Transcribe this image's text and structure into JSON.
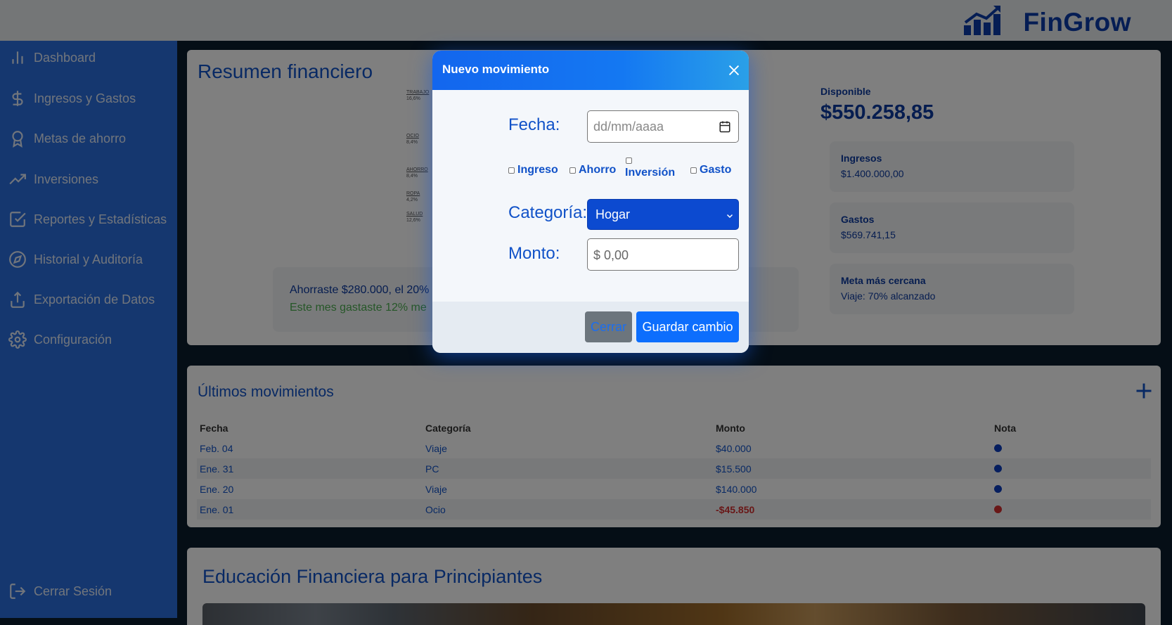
{
  "brand": {
    "name": "FinGrow",
    "logo_icon": "growth-chart-icon"
  },
  "sidebar": {
    "items": [
      {
        "label": "Dashboard",
        "icon": "bar-chart-icon"
      },
      {
        "label": "Ingresos y Gastos",
        "icon": "dollar-icon"
      },
      {
        "label": "Metas de ahorro",
        "icon": "award-icon"
      },
      {
        "label": "Inversiones",
        "icon": "trending-up-icon"
      },
      {
        "label": "Reportes y Estadísticas",
        "icon": "check-square-icon"
      },
      {
        "label": "Historial y Auditoría",
        "icon": "compass-icon"
      },
      {
        "label": "Exportación de Datos",
        "icon": "upload-icon"
      },
      {
        "label": "Configuración",
        "icon": "gear-icon"
      }
    ],
    "logout": {
      "label": "Cerrar Sesión",
      "icon": "logout-icon"
    }
  },
  "summary": {
    "title": "Resumen financiero",
    "chart_labels": [
      {
        "name": "TRABAJO",
        "pct": "16,6%"
      },
      {
        "name": "OCIO",
        "pct": "8,4%"
      },
      {
        "name": "AHORRO",
        "pct": "8,4%"
      },
      {
        "name": "ROPA",
        "pct": "4,2%"
      },
      {
        "name": "SALUD",
        "pct": "12,6%"
      }
    ],
    "tip_line1": "Ahorraste $280.000, el 20%",
    "tip_line2": "Este mes gastaste 12% me",
    "available_label": "Disponible",
    "available_value": "$550.258,85",
    "stats": [
      {
        "label": "Ingresos",
        "value": "$1.400.000,00"
      },
      {
        "label": "Gastos",
        "value": "$569.741,15"
      },
      {
        "label": "Meta más cercana",
        "value": "Viaje: 70% alcanzado"
      }
    ]
  },
  "movements": {
    "title": "Últimos movimientos",
    "columns": [
      "Fecha",
      "Categoría",
      "Monto",
      "Nota"
    ],
    "rows": [
      {
        "fecha": "Feb. 04",
        "categoria": "Viaje",
        "monto": "$40.000",
        "nota_color": "#0c3dbf"
      },
      {
        "fecha": "Ene. 31",
        "categoria": "PC",
        "monto": "$15.500",
        "nota_color": "#0c3dbf"
      },
      {
        "fecha": "Ene. 20",
        "categoria": "Viaje",
        "monto": "$140.000",
        "nota_color": "#0c3dbf"
      },
      {
        "fecha": "Ene. 01",
        "categoria": "Ocio",
        "monto": "-$45.850",
        "nota_color": "#d32f2f"
      }
    ]
  },
  "education": {
    "title": "Educación Financiera para Principiantes"
  },
  "modal": {
    "title": "Nuevo movimiento",
    "fecha_label": "Fecha:",
    "fecha_placeholder": "dd/mm/aaaa",
    "types": [
      "Ingreso",
      "Ahorro",
      "Inversión",
      "Gasto"
    ],
    "categoria_label": "Categoría:",
    "categoria_value": "Hogar",
    "monto_label": "Monto:",
    "monto_placeholder": "$ 0,00",
    "close_label": "Cerrar",
    "save_label": "Guardar cambio"
  },
  "colors": {
    "primary": "#0d6efd",
    "sidebar": "#2a6fde",
    "text_blue": "#1152c8",
    "negative": "#d32f2f",
    "positive": "#4caf50"
  }
}
